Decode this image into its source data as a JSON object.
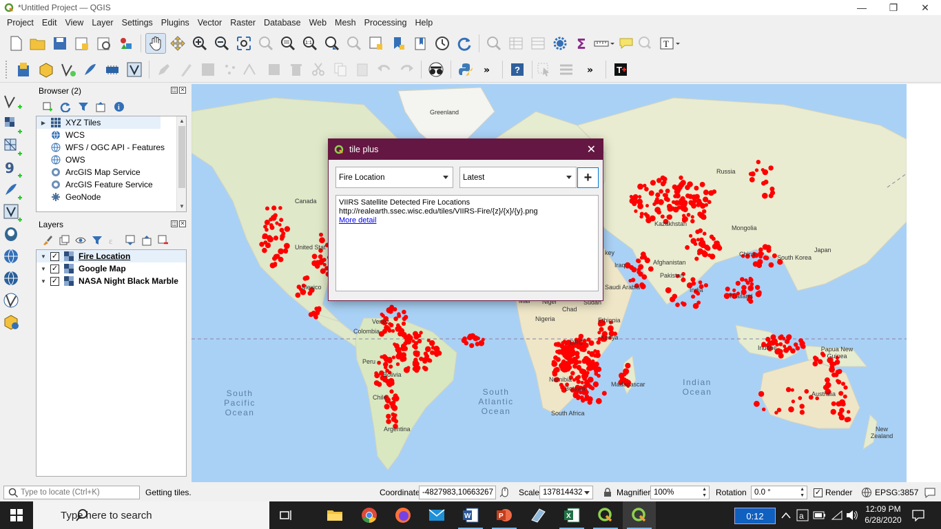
{
  "window": {
    "title": "*Untitled Project — QGIS",
    "minimize": "—",
    "maximize": "❐",
    "close": "✕"
  },
  "menu": [
    "Project",
    "Edit",
    "View",
    "Layer",
    "Settings",
    "Plugins",
    "Vector",
    "Raster",
    "Database",
    "Web",
    "Mesh",
    "Processing",
    "Help"
  ],
  "browser": {
    "title": "Browser (2)",
    "items": [
      {
        "label": "XYZ Tiles",
        "icon": "xyz-tiles-icon"
      },
      {
        "label": "WCS",
        "icon": "globe-icon"
      },
      {
        "label": "WFS / OGC API - Features",
        "icon": "globe-icon"
      },
      {
        "label": "OWS",
        "icon": "globe-icon"
      },
      {
        "label": "ArcGIS Map Service",
        "icon": "arcgis-icon"
      },
      {
        "label": "ArcGIS Feature Service",
        "icon": "arcgis-icon"
      },
      {
        "label": "GeoNode",
        "icon": "geonode-icon"
      }
    ]
  },
  "layers": {
    "title": "Layers",
    "items": [
      {
        "label": "Fire Location",
        "checked": "✓"
      },
      {
        "label": "Google Map",
        "checked": "✓"
      },
      {
        "label": "NASA Night Black Marble",
        "checked": "✓"
      }
    ]
  },
  "map": {
    "labels": {
      "greenland": "Greenland",
      "canada": "Canada",
      "united_states": "United Stat",
      "mexico": "Mexico",
      "venezuela": "Venez",
      "colombia": "Colombia",
      "peru": "Peru",
      "bolivia": "Bolivia",
      "chile": "Chile",
      "argentina": "Argentina",
      "russia": "Russia",
      "kazakhstan": "Kazakhstan",
      "mongolia": "Mongolia",
      "china": "China",
      "south_korea": "South Korea",
      "japan": "Japan",
      "iraq": "Iraq",
      "afghanistan": "Afghanistan",
      "pakistan": "Pakistan",
      "india": "India",
      "saudi": "Saudi Arabia",
      "thailand": "Thailand",
      "mali": "Mali",
      "niger": "Niger",
      "chad": "Chad",
      "sudan": "Sudan",
      "nigeria": "Nigeria",
      "ethiopia": "Ethiopia",
      "kenya": "Kenya",
      "drc": "DRC",
      "namibia": "Namibia",
      "botswana": "Botswa",
      "madagascar": "Madagascar",
      "south_africa": "South Africa",
      "indonesia": "Indone",
      "papua": "Papua New Guinea",
      "australia": "Australia",
      "nz": "New Zealand",
      "turkey": "key"
    },
    "oceans": {
      "south_pacific": "South Pacific Ocean",
      "south_atlantic": "South Atlantic Ocean",
      "indian": "Indian Ocean"
    },
    "fire_color": "#ff0000"
  },
  "dialog": {
    "title": "tile plus",
    "close": "✕",
    "source_select": "Fire Location",
    "time_select": "Latest",
    "add_label": "+",
    "description": "VIIRS Satellite Detected Fire Locations",
    "url": "http://realearth.ssec.wisc.edu/tiles/VIIRS-Fire/{z}/{x}/{y}.png",
    "link": "More detail"
  },
  "status": {
    "locate_placeholder": "Type to locate (Ctrl+K)",
    "message": "Getting tiles.",
    "coordinate_label": "Coordinate",
    "coordinate": "-4827983,10663267",
    "scale_label": "Scale",
    "scale": "137814432",
    "magnifier_label": "Magnifier",
    "magnifier": "100%",
    "rotation_label": "Rotation",
    "rotation": "0.0 °",
    "render_label": "Render",
    "crs": "EPSG:3857"
  },
  "taskbar": {
    "search_placeholder": "Type here to search",
    "timer": "0:12",
    "time": "12:09 PM",
    "date": "6/28/2020"
  }
}
